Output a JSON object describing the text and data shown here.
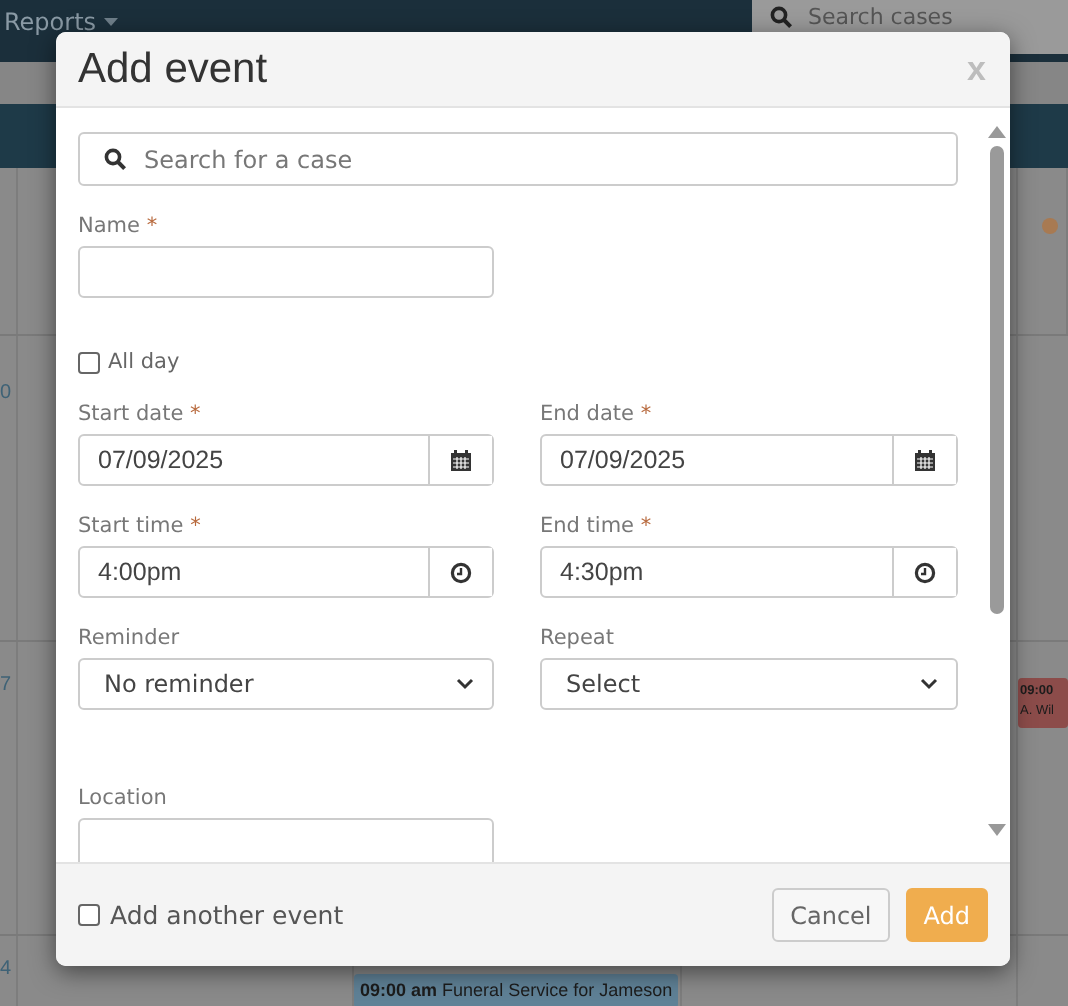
{
  "background": {
    "nav": {
      "menu": "Reports",
      "search_placeholder": "Search cases"
    },
    "calendar": {
      "weeks": [
        {
          "day": "0"
        },
        {
          "day": "7",
          "events": [
            {
              "time": "09:00",
              "title": "A. Wil",
              "color": "#8c4c4a"
            }
          ]
        },
        {
          "day": "4",
          "events": [
            {
              "time": "09:00 am",
              "title": "Funeral Service for Jameson",
              "color": "#5f8196"
            }
          ]
        }
      ]
    }
  },
  "dialog": {
    "title": "Add event",
    "close": "x",
    "rows": [
      [
        {
          "kind": "search",
          "placeholder": "Search for a case"
        }
      ],
      [
        {
          "kind": "text",
          "label": "Name",
          "mark": "*"
        }
      ],
      [
        {
          "kind": "checkbox",
          "label": "All day",
          "checked": false
        }
      ],
      [
        {
          "kind": "date",
          "label": "Start date",
          "mark": "*",
          "value": "07/09/2025"
        },
        {
          "kind": "date",
          "label": "End date",
          "mark": "*",
          "value": "07/09/2025"
        }
      ],
      [
        {
          "kind": "time",
          "label": "Start time",
          "mark": "*",
          "value": "4:00pm"
        },
        {
          "kind": "time",
          "label": "End time",
          "mark": "*",
          "value": "4:30pm"
        }
      ],
      [
        {
          "kind": "select",
          "label": "Reminder",
          "value": "No reminder"
        },
        {
          "kind": "select",
          "label": "Repeat",
          "value": "Select"
        }
      ],
      [
        {
          "kind": "text",
          "label": "Location"
        }
      ]
    ],
    "footer": {
      "add_another": {
        "label": "Add another event",
        "checked": false
      },
      "buttons": [
        {
          "kind": "default",
          "label": "Cancel"
        },
        {
          "kind": "primary",
          "label": "Add"
        }
      ]
    }
  }
}
